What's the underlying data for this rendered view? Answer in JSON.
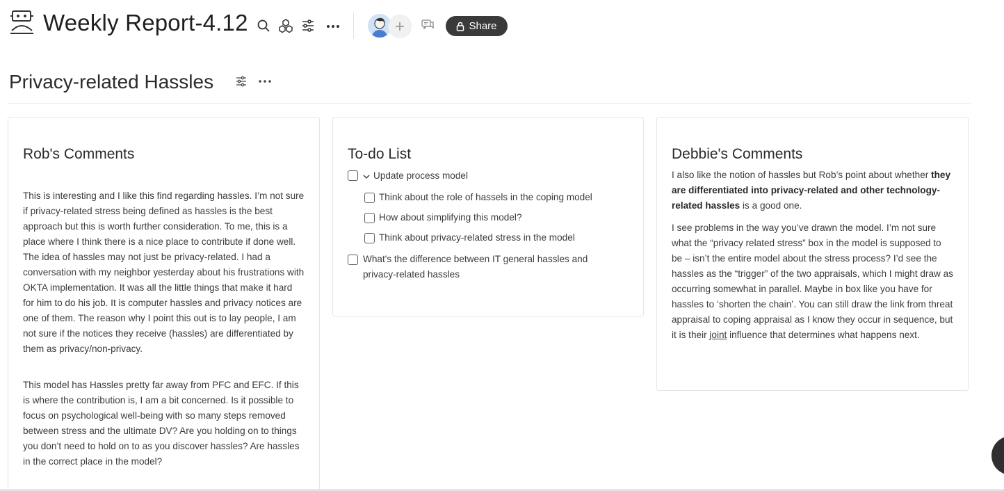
{
  "header": {
    "title": "Weekly Report-4.12",
    "icons": [
      "board-icon",
      "search-icon",
      "cube-icon",
      "sliders-icon",
      "more-icon",
      "comment-icon"
    ],
    "share_label": "Share"
  },
  "section": {
    "title": "Privacy-related Hassles"
  },
  "rob": {
    "title": "Rob's Comments",
    "p1": "This is interesting and I like this find regarding hassles. I’m not sure if privacy-related stress being defined as hassles is the best approach but this is worth further consideration. To me, this is a place where I think there is a nice place to contribute if done well. The idea of hassles may not just be privacy-related. I had a conversation with my neighbor yesterday about his frustrations with OKTA implementation. It was all the little things that make it hard for him to do his job. It is computer hassles and privacy notices are one of them. The reason why I point this out is to lay people, I am not sure if the notices they receive (hassles) are differentiated by them as privacy/non-privacy.",
    "p2": "This model has Hassles pretty far away from PFC and EFC.  If this is where the contribution is, I am a bit concerned.  Is it possible to focus on psychological well-being with so many steps removed between stress and the ultimate DV?  Are you holding on to things you don’t need to hold on to as you discover hassles?   Are hassles in the correct place in the model?"
  },
  "todo": {
    "title": "To-do List",
    "item1": "Update process model",
    "sub1": "Think about the role of hassels in the coping model",
    "sub2": "How about simplifying this model?",
    "sub3": "Think about privacy-related stress in the model",
    "item2": "What's the difference between IT general hassles and privacy-related hassles"
  },
  "debbie": {
    "title": "Debbie's Comments",
    "p1_a": "I also like the notion of hassles but Rob’s point about whether ",
    "p1_bold": "they are differentiated into privacy-related and other technology-related hassles",
    "p1_b": " is a good one.",
    "p2_a": "I see problems in the way you’ve drawn the model.  I’m not sure what the “privacy related stress” box in the model is supposed to be – isn’t the entire model about the stress process?  I’d see the hassles as the “trigger” of the two appraisals, which I might draw as occurring somewhat in parallel.  Maybe in box like you have for hassles to ‘shorten the chain’. You can still draw the link from threat appraisal to coping appraisal as I know they occur in sequence, but it is their ",
    "p2_u": "joint",
    "p2_b": " influence that determines what happens next."
  }
}
